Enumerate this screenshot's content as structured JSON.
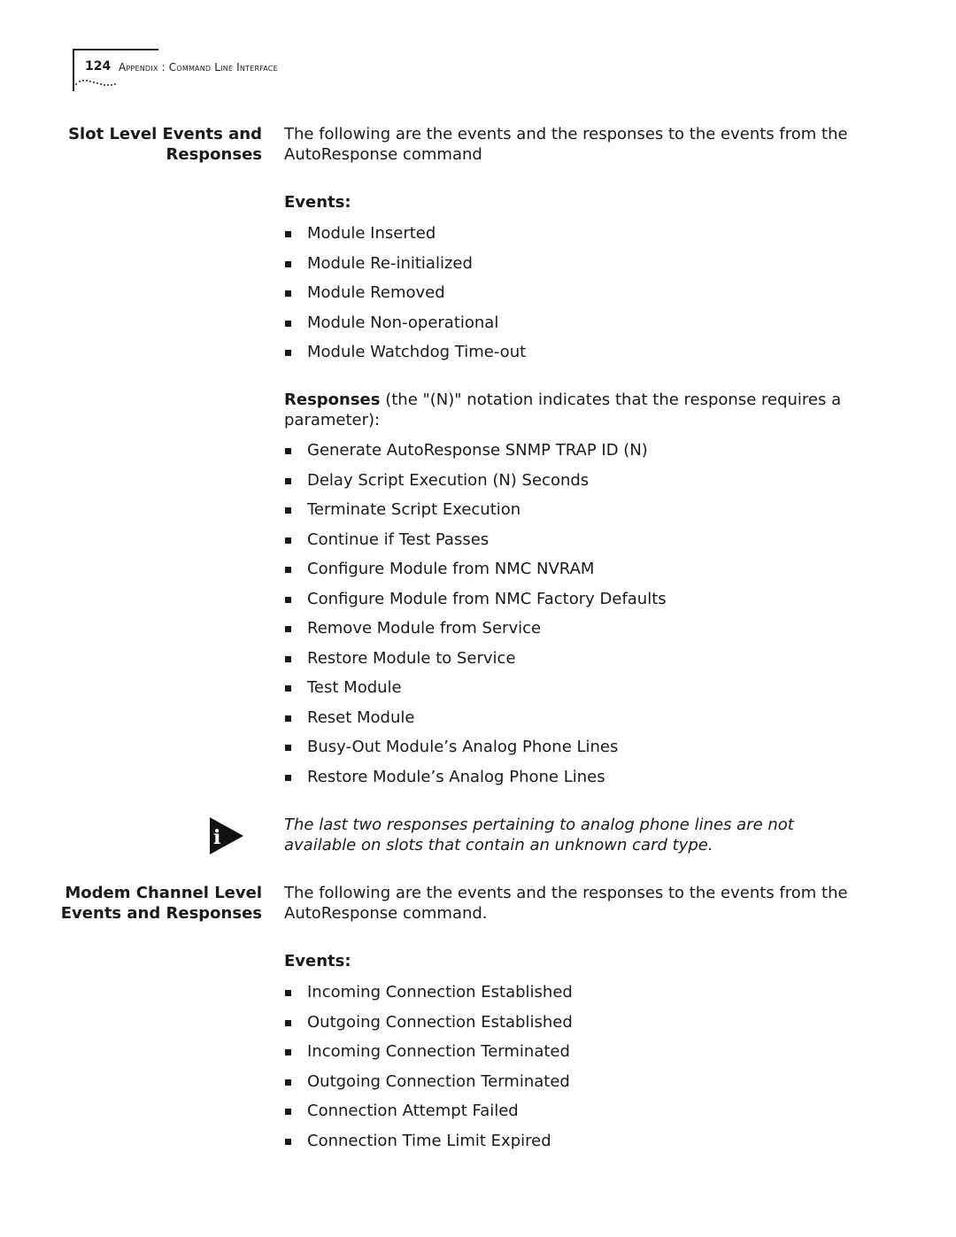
{
  "header": {
    "page_number": "124",
    "running_head": "Appendix : Command Line Interface"
  },
  "sections": [
    {
      "side_heading_line1": "Slot Level Events and",
      "side_heading_line2": "Responses",
      "intro": "The following are the events and the responses to the events from the AutoResponse command",
      "events_label": "Events:",
      "events": [
        "Module Inserted",
        "Module Re-initialized",
        "Module Removed",
        "Module Non-operational",
        "Module Watchdog Time-out"
      ],
      "responses_label": "Responses",
      "responses_intro": " (the \"(N)\" notation indicates that the response requires a parameter):",
      "responses": [
        "Generate AutoResponse SNMP TRAP ID (N)",
        "Delay Script Execution (N) Seconds",
        "Terminate Script Execution",
        "Continue if Test Passes",
        "Configure Module from NMC NVRAM",
        "Configure Module from NMC Factory Defaults",
        "Remove Module from Service",
        "Restore Module to Service",
        "Test Module",
        "Reset Module",
        "Busy-Out Module’s Analog Phone Lines",
        "Restore Module’s Analog Phone Lines"
      ],
      "note": {
        "icon": "info-icon",
        "text": "The last two responses pertaining to analog phone lines are not available on slots that contain an unknown card type."
      }
    },
    {
      "side_heading_line1": "Modem Channel Level",
      "side_heading_line2": "Events and Responses",
      "intro": "The following are the events and the responses to the events from the AutoResponse command.",
      "events_label": "Events:",
      "events": [
        "Incoming Connection Established",
        "Outgoing Connection Established",
        "Incoming Connection Terminated",
        "Outgoing Connection Terminated",
        "Connection Attempt Failed",
        "Connection Time Limit Expired"
      ]
    }
  ]
}
